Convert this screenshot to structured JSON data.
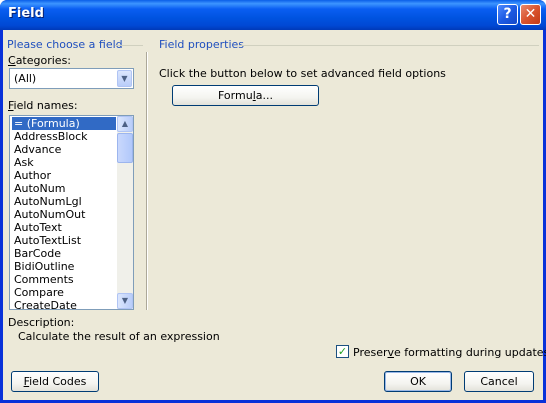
{
  "window": {
    "title": "Field",
    "help_glyph": "?",
    "close_glyph": "✕"
  },
  "left": {
    "group_title": "Please choose a field",
    "categories_label_mnemonic": "C",
    "categories_label_rest": "ategories:",
    "categories_value": "(All)",
    "field_names_label_mnemonic": "F",
    "field_names_label_rest": "ield names:",
    "fields": [
      "= (Formula)",
      "AddressBlock",
      "Advance",
      "Ask",
      "Author",
      "AutoNum",
      "AutoNumLgl",
      "AutoNumOut",
      "AutoText",
      "AutoTextList",
      "BarCode",
      "BidiOutline",
      "Comments",
      "Compare",
      "CreateDate"
    ],
    "selected_index": 0
  },
  "right": {
    "group_title": "Field properties",
    "instruction": "Click the button below to set advanced field options",
    "formula_button_pre": "Formu",
    "formula_button_mnemonic": "l",
    "formula_button_post": "a..."
  },
  "description": {
    "label": "Description:",
    "text": "Calculate the result of an expression"
  },
  "preserve": {
    "checked": true,
    "label_pre": "Preser",
    "label_mnemonic": "v",
    "label_post": "e formatting during updates"
  },
  "footer": {
    "field_codes_mnemonic": "F",
    "field_codes_rest": "ield Codes",
    "ok_label": "OK",
    "cancel_label": "Cancel"
  }
}
